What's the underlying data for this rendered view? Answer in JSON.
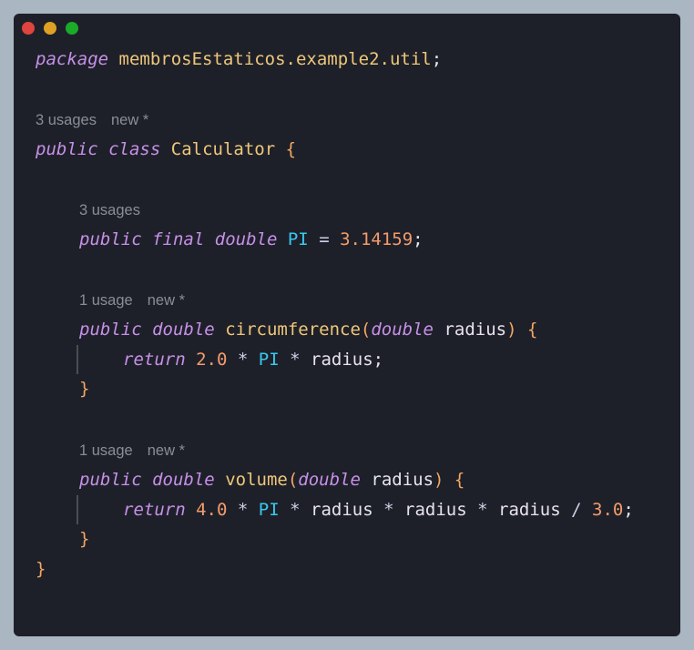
{
  "window": {
    "buttons": [
      "close",
      "minimize",
      "maximize"
    ],
    "colors": {
      "close": "#e0443e",
      "minimize": "#dea123",
      "maximize": "#1aab29",
      "background": "#1e2029"
    }
  },
  "code": {
    "package_kw": "package",
    "package_name": "membrosEstaticos.example2.util",
    "semicolon": ";",
    "class_hint": {
      "usages": "3 usages",
      "tag": "new *"
    },
    "class_kw1": "public",
    "class_kw2": "class",
    "class_name": "Calculator",
    "open_brace": "{",
    "close_brace": "}",
    "field_hint": {
      "usages": "3 usages"
    },
    "field_kw1": "public",
    "field_kw2": "final",
    "field_type": "double",
    "field_name": "PI",
    "assign_op": "=",
    "field_value": "3.14159",
    "method1": {
      "hint_usages": "1 usage",
      "hint_tag": "new *",
      "kw": "public",
      "type": "double",
      "name": "circumference",
      "param_type": "double",
      "param_name": "radius",
      "return_kw": "return",
      "lit": "2.0",
      "op1": "*",
      "const": "PI",
      "op2": "*",
      "var": "radius"
    },
    "method2": {
      "hint_usages": "1 usage",
      "hint_tag": "new *",
      "kw": "public",
      "type": "double",
      "name": "volume",
      "param_type": "double",
      "param_name": "radius",
      "return_kw": "return",
      "lit": "4.0",
      "op1": "*",
      "const": "PI",
      "op2": "*",
      "var1": "radius",
      "op3": "*",
      "var2": "radius",
      "op4": "*",
      "var3": "radius",
      "op5": "/",
      "lit2": "3.0"
    },
    "colors": {
      "keyword": "#c690e8",
      "class_name": "#eec77a",
      "brace": "#f2a663",
      "constant": "#38c9f0",
      "number": "#f39c6b",
      "hint": "#8a8d96"
    }
  }
}
